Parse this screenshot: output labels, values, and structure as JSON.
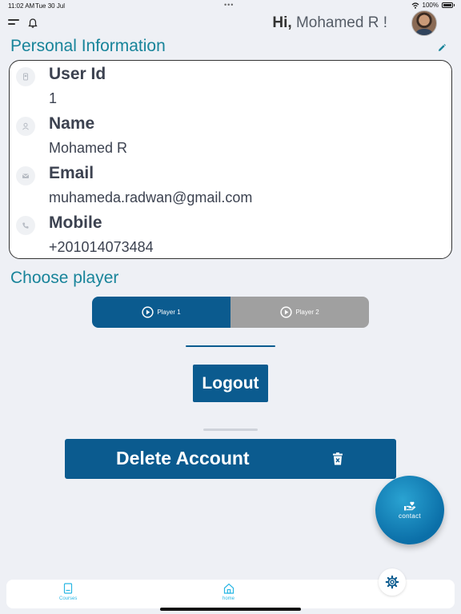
{
  "status": {
    "time": "11:02 AM",
    "date": "Tue 30 Jul",
    "battery": "100%"
  },
  "header": {
    "greeting_prefix": "Hi,",
    "user_name": "Mohamed R !"
  },
  "personal_info": {
    "title": "Personal Information",
    "rows": [
      {
        "label": "User Id",
        "value": "1",
        "icon": "id-card-icon"
      },
      {
        "label": "Name",
        "value": "Mohamed R",
        "icon": "person-icon"
      },
      {
        "label": "Email",
        "value": "muhameda.radwan@gmail.com",
        "icon": "mail-icon"
      },
      {
        "label": "Mobile",
        "value": "+201014073484",
        "icon": "phone-icon"
      }
    ]
  },
  "choose_player": {
    "title": "Choose player",
    "options": [
      {
        "label": "Player 1",
        "selected": true
      },
      {
        "label": "Player 2",
        "selected": false
      }
    ]
  },
  "actions": {
    "logout_label": "Logout",
    "delete_label": "Delete Account"
  },
  "contact": {
    "label": "contact"
  },
  "tabs": [
    {
      "label": "Courses",
      "icon": "book-icon"
    },
    {
      "label": "home",
      "icon": "home-icon"
    }
  ],
  "colors": {
    "primary": "#0b5b8f",
    "accent_teal": "#18849a",
    "tab_active": "#29b6e3",
    "inactive": "#a0a0a0"
  }
}
